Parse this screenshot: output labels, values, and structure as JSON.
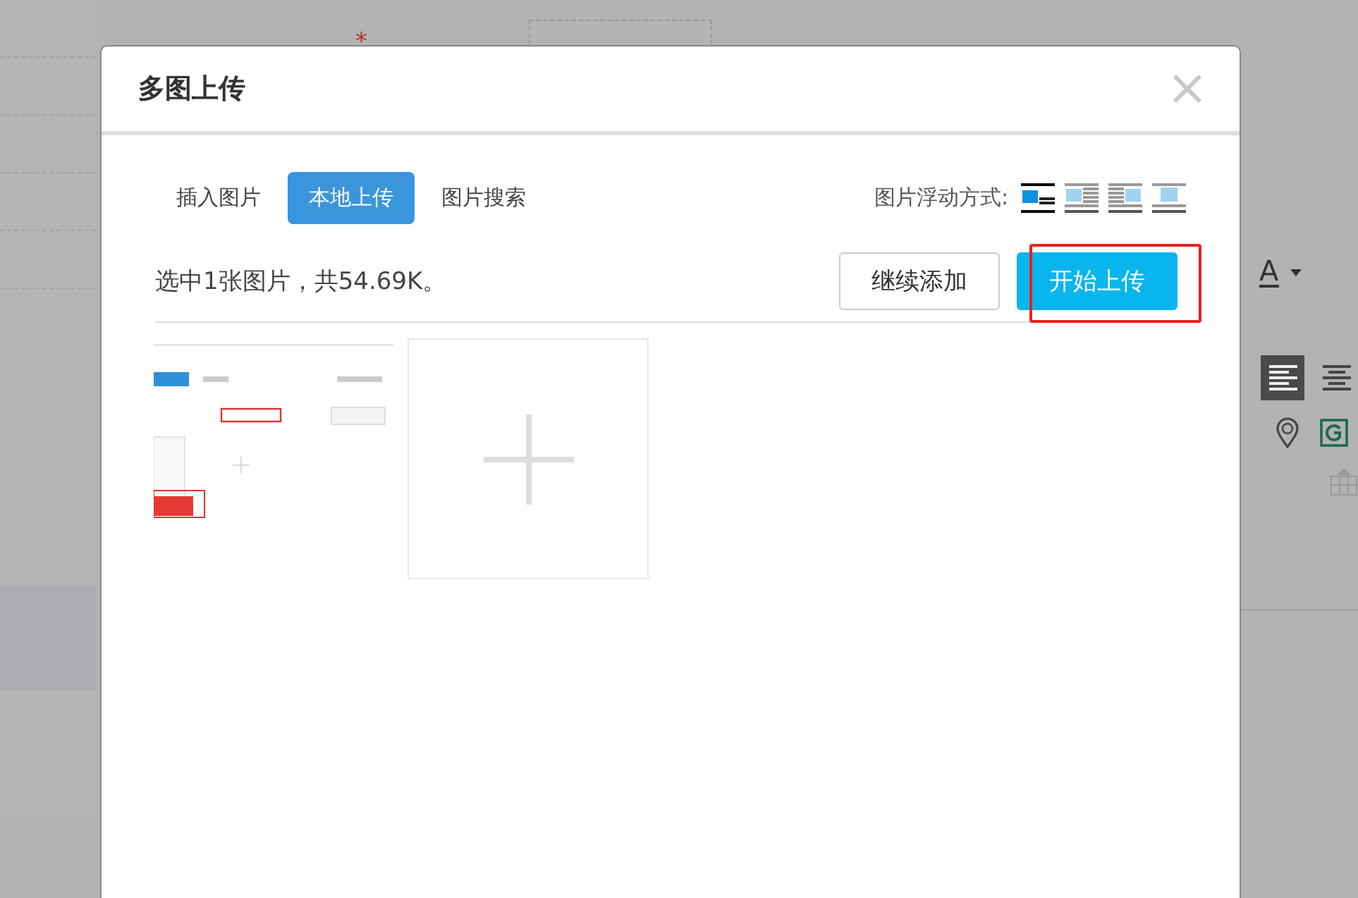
{
  "background": {
    "required_mark": "*",
    "font_color_label": "A",
    "align_buttons": [
      {
        "kind": "left",
        "selected": true
      },
      {
        "kind": "center",
        "selected": false
      }
    ]
  },
  "dialog": {
    "title": "多图上传",
    "tabs": [
      {
        "label": "插入图片",
        "selected": false
      },
      {
        "label": "本地上传",
        "selected": true
      },
      {
        "label": "图片搜索",
        "selected": false
      }
    ],
    "float_label": "图片浮动方式:",
    "float_options": [
      {
        "kind": "none",
        "selected": true
      },
      {
        "kind": "left",
        "selected": false
      },
      {
        "kind": "right",
        "selected": false
      },
      {
        "kind": "center",
        "selected": false
      }
    ],
    "status": "选中1张图片，共54.69K。",
    "buttons": [
      {
        "label": "继续添加",
        "kind": "secondary",
        "highlighted": false
      },
      {
        "label": "开始上传",
        "kind": "primary",
        "highlighted": true
      }
    ],
    "images": [
      {
        "kind": "picture"
      },
      {
        "kind": "add"
      }
    ]
  }
}
